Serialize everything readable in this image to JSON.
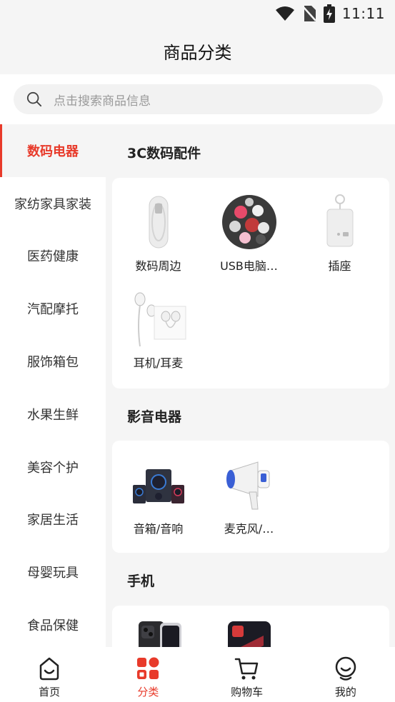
{
  "status_bar": {
    "time": "11:11"
  },
  "header": {
    "title": "商品分类"
  },
  "search": {
    "placeholder": "点击搜索商品信息"
  },
  "sidebar": {
    "items": [
      {
        "label": "数码电器",
        "active": true
      },
      {
        "label": "家纺家具家装"
      },
      {
        "label": "医药健康"
      },
      {
        "label": "汽配摩托"
      },
      {
        "label": "服饰箱包"
      },
      {
        "label": "水果生鲜"
      },
      {
        "label": "美容个护"
      },
      {
        "label": "家居生活"
      },
      {
        "label": "母婴玩具"
      },
      {
        "label": "食品保健"
      }
    ]
  },
  "sections": [
    {
      "title": "3C数码配件",
      "items": [
        {
          "label": "数码周边",
          "icon": "cable-product-image"
        },
        {
          "label": "USB电脑…",
          "icon": "sticker-pack-product-image"
        },
        {
          "label": "插座",
          "icon": "socket-product-image"
        },
        {
          "label": "耳机/耳麦",
          "icon": "earphones-product-image"
        }
      ]
    },
    {
      "title": "影音电器",
      "items": [
        {
          "label": "音箱/音响",
          "icon": "speakers-product-image"
        },
        {
          "label": "麦克风/…",
          "icon": "megaphone-product-image"
        }
      ]
    },
    {
      "title": "手机",
      "items": [
        {
          "label": "",
          "icon": "smartphone-product-image"
        },
        {
          "label": "",
          "icon": "phone-case-product-image"
        }
      ]
    }
  ],
  "tabbar": {
    "items": [
      {
        "label": "首页",
        "icon": "home-icon"
      },
      {
        "label": "分类",
        "icon": "category-icon",
        "active": true
      },
      {
        "label": "购物车",
        "icon": "cart-icon"
      },
      {
        "label": "我的",
        "icon": "profile-icon"
      }
    ]
  },
  "colors": {
    "accent": "#e83a2a",
    "background": "#f5f5f5",
    "card": "#ffffff"
  }
}
